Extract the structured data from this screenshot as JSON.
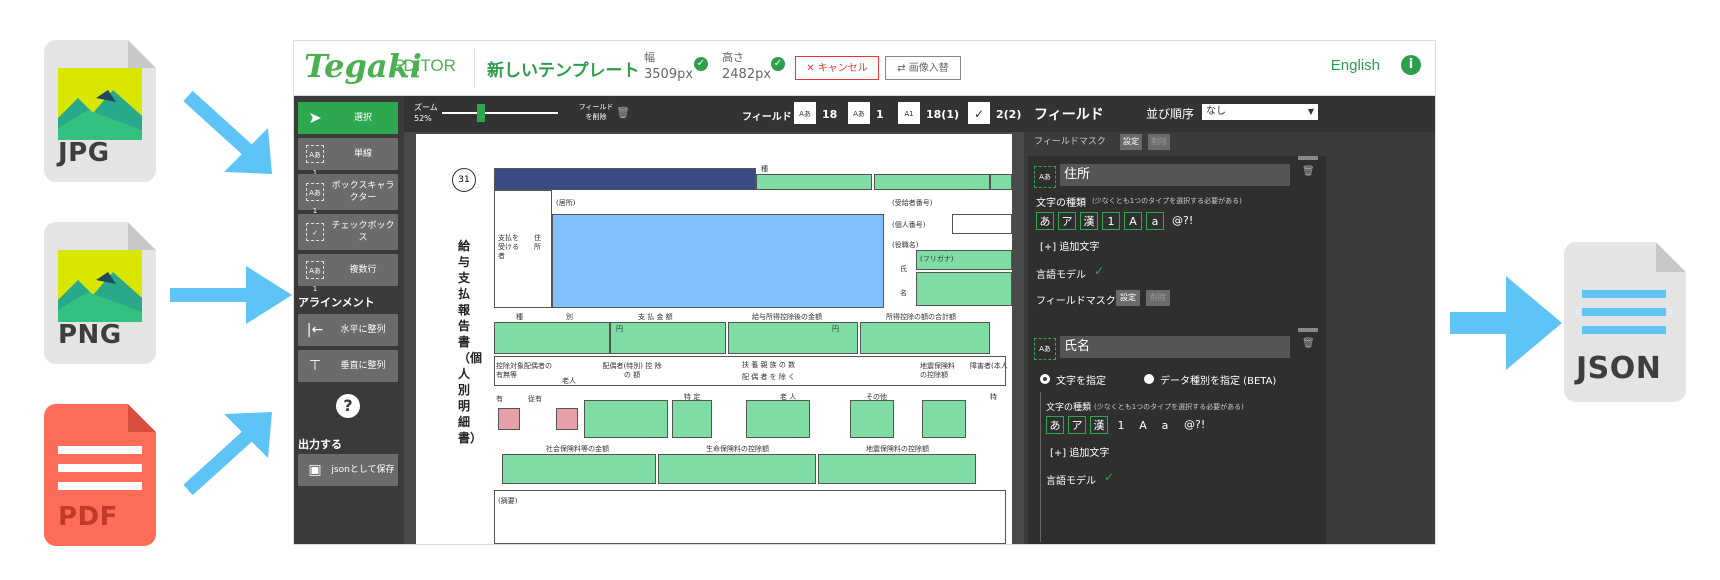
{
  "inputs": [
    {
      "label": "JPG",
      "color": "#e4e4e4"
    },
    {
      "label": "PNG",
      "color": "#e4e4e4"
    },
    {
      "label": "PDF",
      "color": "#ff6d5a"
    }
  ],
  "output": {
    "label": "JSON",
    "color": "#e4e4e4"
  },
  "colors": {
    "arrow": "#5ec3f5",
    "brand_green": "#2e9e4d",
    "field_green": "#7fdca5",
    "field_blue": "#82bfff",
    "dark": "#3a3a3a"
  },
  "topbar": {
    "logo": "Tegaki",
    "editor": "EDITOR",
    "template_name": "新しいテンプレート",
    "width_label": "幅",
    "width_value": "3509px",
    "height_label": "高さ",
    "height_value": "2482px",
    "cancel": "キャンセル",
    "replace_image": "画像入替",
    "language": "English",
    "info": "i"
  },
  "left": {
    "tools": [
      {
        "icon": "select-cursor-icon",
        "label": "選択",
        "active": true
      },
      {
        "icon": "single-line-icon",
        "label": "単線"
      },
      {
        "icon": "box-character-icon",
        "label": "ボックスキャラクター"
      },
      {
        "icon": "checkbox-icon",
        "label": "チェックボックス"
      },
      {
        "icon": "multi-line-icon",
        "label": "複数行"
      }
    ],
    "align_label": "アラインメント",
    "align_h": "水平に整列",
    "align_v": "垂直に整列",
    "help": "?",
    "output_label": "出力する",
    "save_json": "jsonとして保存"
  },
  "center": {
    "zoom_label": "ズーム",
    "zoom_value": "52%",
    "zoom_level": 0.52,
    "delete_field": "フィールドを削除",
    "fields_label": "フィールド",
    "counts": [
      "18",
      "1",
      "18(1)",
      "2(2)"
    ],
    "doc": {
      "number": "31",
      "title": "給与支払報告書（個人別明細書）",
      "labels": [
        "種",
        "別",
        "支 払 金 額",
        "給与所得控除後の金額",
        "所得控除の額の合計額",
        "円",
        "扶 養 親 族 の 数",
        "配 偶 者 を 除 く",
        "控除対象配偶者の有無等",
        "配偶者(特別) 控 除 の 額",
        "老人",
        "有",
        "従有",
        "特 定",
        "老 人",
        "その他",
        "16歳未満扶養親族の数",
        "社会保険料等の金額",
        "生命保険料の控除額",
        "地震保険料の控除額",
        "(摘要)",
        "(受給者番号)",
        "(個人番号)",
        "(役職名)",
        "氏",
        "名",
        "(フリガナ)",
        "支払を受ける者",
        "住所",
        "(居所)",
        "個人番号",
        "給与所得",
        "障害者(本人",
        "特"
      ]
    }
  },
  "right": {
    "title": "フィールド",
    "sort_label": "並び順序",
    "sort_value": "なし",
    "mask_label": "フィールドマスク",
    "set": "設定",
    "clear": "削除",
    "card1": {
      "name": "住所",
      "char_types_label": "文字の種類",
      "char_types_hint": "(少なくとも1つのタイプを選択する必要がある)",
      "chips": [
        "あ",
        "ア",
        "漢",
        "1",
        "A",
        "a",
        "@?!"
      ],
      "add_chars": "[+] 追加文字",
      "lang_model": "言語モデル",
      "mask": "フィールドマスク",
      "set": "設定",
      "clear": "削除"
    },
    "card2": {
      "name": "氏名",
      "opt1": "文字を指定",
      "opt2": "データ種別を指定 (BETA)",
      "char_types_label": "文字の種類",
      "char_types_hint": "(少なくとも1つのタイプを選択する必要がある)",
      "chips": [
        "あ",
        "ア",
        "漢",
        "1",
        "A",
        "a",
        "@?!"
      ],
      "add_chars": "[+] 追加文字",
      "lang_model": "言語モデル"
    }
  }
}
